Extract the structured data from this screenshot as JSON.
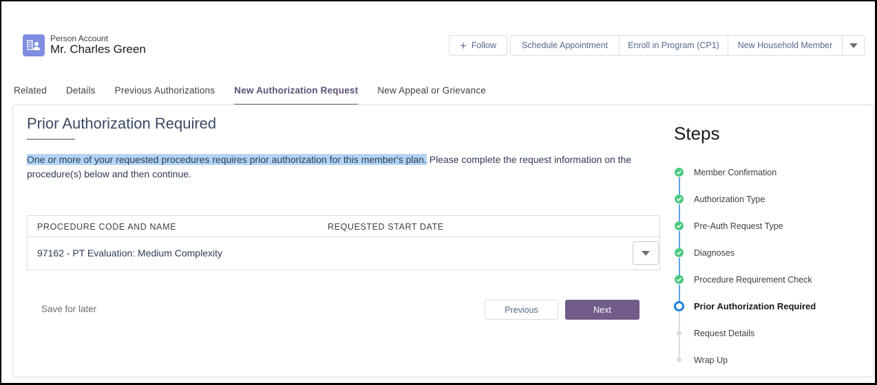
{
  "header": {
    "object_type": "Person Account",
    "record_name": "Mr. Charles Green",
    "icon": "person-account-icon",
    "actions": {
      "follow": "Follow",
      "schedule": "Schedule Appointment",
      "enroll": "Enroll in Program (CP1)",
      "household": "New Household Member"
    }
  },
  "tabs": [
    {
      "label": "Related",
      "active": false
    },
    {
      "label": "Details",
      "active": false
    },
    {
      "label": "Previous Authorizations",
      "active": false
    },
    {
      "label": "New Authorization Request",
      "active": true
    },
    {
      "label": "New Appeal or Grievance",
      "active": false
    }
  ],
  "main": {
    "title": "Prior Authorization Required",
    "message_highlighted": "One or more of your requested procedures requires prior authorization for this member's plan.",
    "message_rest": " Please complete the request information on the procedure(s) below and then continue.",
    "table": {
      "columns": [
        "PROCEDURE CODE AND NAME",
        "REQUESTED START DATE"
      ],
      "rows": [
        {
          "procedure": "97162 - PT Evaluation: Medium Complexity",
          "start_date": ""
        }
      ]
    },
    "save_for_later": "Save for later",
    "previous": "Previous",
    "next": "Next"
  },
  "steps": {
    "title": "Steps",
    "items": [
      {
        "label": "Member Confirmation",
        "status": "complete"
      },
      {
        "label": "Authorization Type",
        "status": "complete"
      },
      {
        "label": "Pre-Auth Request Type",
        "status": "complete"
      },
      {
        "label": "Diagnoses",
        "status": "complete"
      },
      {
        "label": "Procedure Requirement Check",
        "status": "complete"
      },
      {
        "label": "Prior Authorization Required",
        "status": "current"
      },
      {
        "label": "Request Details",
        "status": "pending"
      },
      {
        "label": "Wrap Up",
        "status": "pending"
      }
    ]
  },
  "colors": {
    "brand_purple": "#725c89",
    "complete_green": "#4bca81",
    "current_blue": "#1b7fdc",
    "highlight": "#b3d4f5"
  }
}
